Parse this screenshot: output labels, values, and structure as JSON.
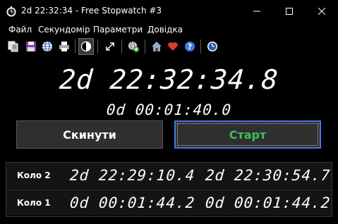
{
  "window": {
    "title": "2d 22:32:34 - Free Stopwatch #3",
    "controls": [
      "minimize",
      "maximize",
      "close"
    ]
  },
  "menu": {
    "items": [
      "Файл",
      "Секундомір",
      "Параметри",
      "Довідка"
    ]
  },
  "toolbar": {
    "icons": [
      "copy-icon",
      "save-icon",
      "globe-icon",
      "print-icon",
      "contrast-icon",
      "fullscreen-icon",
      "add-web-icon",
      "home-icon",
      "heart-icon",
      "help-icon",
      "clock-icon"
    ],
    "active": "contrast-icon"
  },
  "stopwatch": {
    "main_time": "2d 22:32:34.8",
    "current_lap_time": "0d 00:01:40.0"
  },
  "buttons": {
    "reset_label": "Скинути",
    "start_label": "Старт"
  },
  "laps": [
    {
      "label": "Коло 2",
      "split": "2d 22:29:10.4",
      "total": "2d 22:30:54.7"
    },
    {
      "label": "Коло 1",
      "split": "0d 00:01:44.2",
      "total": "0d 00:01:44.2"
    }
  ],
  "colors": {
    "background": "#000000",
    "button_bg": "#2f2f2f",
    "start_text": "#3fbf5f",
    "focus_border": "#3b7de0",
    "heart": "#d93a3a",
    "help": "#3b7de0"
  }
}
